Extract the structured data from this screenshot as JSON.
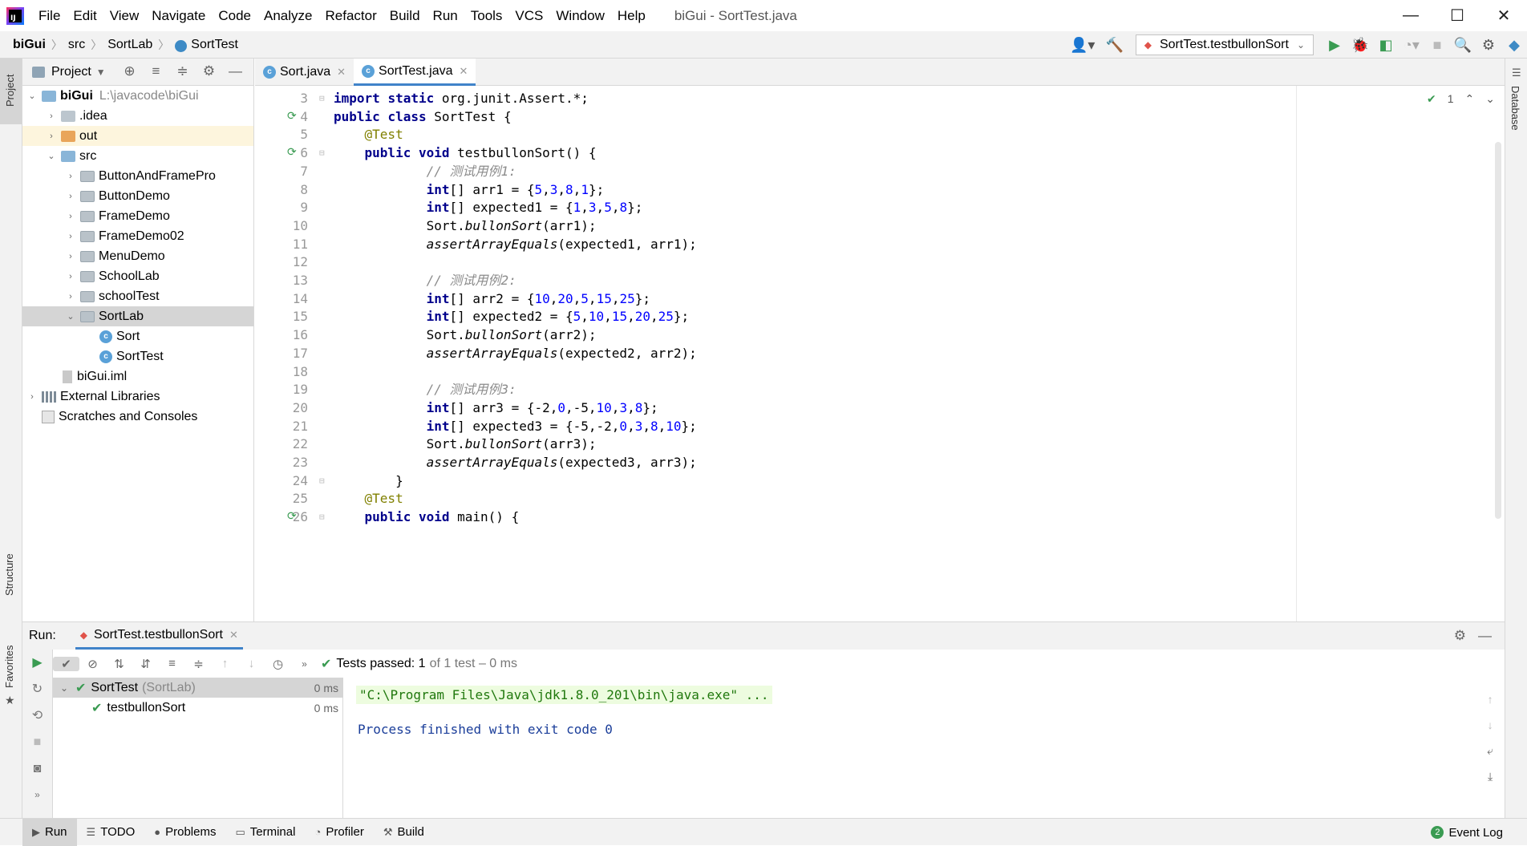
{
  "window": {
    "title": "biGui - SortTest.java",
    "logo_text": "IJ",
    "menu": [
      "File",
      "Edit",
      "View",
      "Navigate",
      "Code",
      "Analyze",
      "Refactor",
      "Build",
      "Run",
      "Tools",
      "VCS",
      "Window",
      "Help"
    ],
    "controls": {
      "minimize": "—",
      "maximize": "☐",
      "close": "✕"
    }
  },
  "breadcrumb": {
    "project": "biGui",
    "folder": "src",
    "package": "SortLab",
    "class": "SortTest"
  },
  "run_config": {
    "label": "SortTest.testbullonSort"
  },
  "left_strip": {
    "project": "Project",
    "structure": "Structure",
    "favorites": "Favorites"
  },
  "right_strip": {
    "database": "Database"
  },
  "project_panel": {
    "title": "Project",
    "tree": [
      {
        "label": "biGui",
        "hint": "L:\\javacode\\biGui"
      },
      {
        "label": ".idea"
      },
      {
        "label": "out"
      },
      {
        "label": "src"
      },
      {
        "label": "ButtonAndFramePro"
      },
      {
        "label": "ButtonDemo"
      },
      {
        "label": "FrameDemo"
      },
      {
        "label": "FrameDemo02"
      },
      {
        "label": "MenuDemo"
      },
      {
        "label": "SchoolLab"
      },
      {
        "label": "schoolTest"
      },
      {
        "label": "SortLab"
      },
      {
        "label": "Sort"
      },
      {
        "label": "SortTest"
      },
      {
        "label": "biGui.iml"
      },
      {
        "label": "External Libraries"
      },
      {
        "label": "Scratches and Consoles"
      }
    ]
  },
  "editor_tabs": [
    {
      "label": "Sort.java"
    },
    {
      "label": "SortTest.java"
    }
  ],
  "editor": {
    "inspection_count": "1",
    "lines": [
      {
        "n": "3",
        "t": "import static org.junit.Assert.*;"
      },
      {
        "n": "4",
        "t": "public class SortTest {"
      },
      {
        "n": "5",
        "t": "    @Test"
      },
      {
        "n": "6",
        "t": "    public void testbullonSort() {"
      },
      {
        "n": "7",
        "t": "            // 测试用例1:"
      },
      {
        "n": "8",
        "t": "            int[] arr1 = {5,3,8,1};"
      },
      {
        "n": "9",
        "t": "            int[] expected1 = {1,3,5,8};"
      },
      {
        "n": "10",
        "t": "            Sort.bullonSort(arr1);"
      },
      {
        "n": "11",
        "t": "            assertArrayEquals(expected1, arr1);"
      },
      {
        "n": "12",
        "t": ""
      },
      {
        "n": "13",
        "t": "            // 测试用例2:"
      },
      {
        "n": "14",
        "t": "            int[] arr2 = {10,20,5,15,25};"
      },
      {
        "n": "15",
        "t": "            int[] expected2 = {5,10,15,20,25};"
      },
      {
        "n": "16",
        "t": "            Sort.bullonSort(arr2);"
      },
      {
        "n": "17",
        "t": "            assertArrayEquals(expected2, arr2);"
      },
      {
        "n": "18",
        "t": ""
      },
      {
        "n": "19",
        "t": "            // 测试用例3:"
      },
      {
        "n": "20",
        "t": "            int[] arr3 = {-2,0,-5,10,3,8};"
      },
      {
        "n": "21",
        "t": "            int[] expected3 = {-5,-2,0,3,8,10};"
      },
      {
        "n": "22",
        "t": "            Sort.bullonSort(arr3);"
      },
      {
        "n": "23",
        "t": "            assertArrayEquals(expected3, arr3);"
      },
      {
        "n": "24",
        "t": "        }"
      },
      {
        "n": "25",
        "t": "    @Test"
      },
      {
        "n": "26",
        "t": "    public void main() {"
      }
    ]
  },
  "run_panel": {
    "title": "Run:",
    "tab": "SortTest.testbullonSort",
    "status_main": "Tests passed: 1",
    "status_detail": "of 1 test – 0 ms",
    "tests": [
      {
        "name": "SortTest",
        "suffix": "(SortLab)",
        "time": "0 ms"
      },
      {
        "name": "testbullonSort",
        "time": "0 ms"
      }
    ],
    "console": [
      "\"C:\\Program Files\\Java\\jdk1.8.0_201\\bin\\java.exe\" ...",
      "Process finished with exit code 0"
    ]
  },
  "statusbar": {
    "items": [
      "Run",
      "TODO",
      "Problems",
      "Terminal",
      "Profiler",
      "Build"
    ],
    "event_log": "Event Log",
    "event_count": "2"
  }
}
